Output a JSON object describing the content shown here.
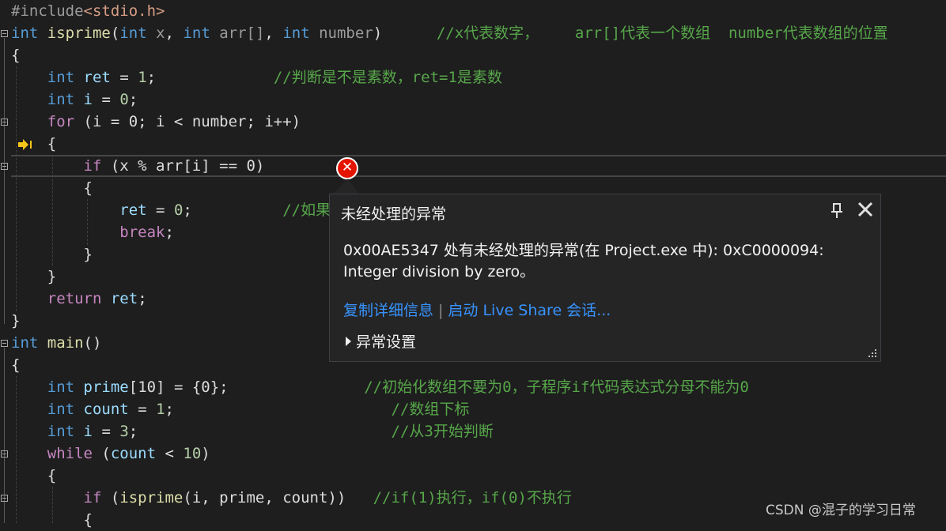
{
  "code": {
    "include": {
      "pp": "#include",
      "file": "<stdio.h>"
    },
    "l1": {
      "kw": "int",
      "fn": "isprime",
      "a1": "int",
      "p1": "x",
      "a2": "int",
      "p2": "arr[]",
      "a3": "int",
      "p3": "number",
      "cm": "//x代表数字，    arr[]代表一个数组  number代表数组的位置"
    },
    "l2": "{",
    "l3": {
      "kw": "int",
      "id": "ret",
      "num": "1",
      "cm": "//判断是不是素数，ret=1是素数"
    },
    "l4": {
      "kw": "int",
      "id": "i",
      "num": "0"
    },
    "l5": {
      "kw": "for",
      "rest": "(i = 0; i < number; i++)"
    },
    "l6": "{",
    "l7": {
      "kw": "if",
      "rest": "(x % arr[i] == 0)"
    },
    "l8": "{",
    "l9": {
      "id": "ret",
      "num": "0",
      "cm": "//如果"
    },
    "l10": {
      "kw": "break"
    },
    "l11": "}",
    "l12": "}",
    "l13": {
      "kw": "return",
      "id": "ret"
    },
    "l14": "}",
    "l15": {
      "kw": "int",
      "fn": "main",
      "rest": "()"
    },
    "l16": "{",
    "l17": {
      "kw": "int",
      "id": "prime",
      "rest": "[10] = {0};",
      "cm": "//初始化数组不要为0，子程序if代码表达式分母不能为0"
    },
    "l18": {
      "kw": "int",
      "id": "count",
      "num": "1",
      "cm": "//数组下标"
    },
    "l19": {
      "kw": "int",
      "id": "i",
      "num": "3",
      "cm": "//从3开始判断"
    },
    "l20": {
      "kw": "while",
      "id": "count",
      "num": "10"
    },
    "l21": "{",
    "l22": {
      "kw": "if",
      "fn": "isprime",
      "args": "(i, prime, count))",
      "cm": "//if(1)执行，if(0)不执行"
    },
    "l23": "{"
  },
  "popup": {
    "title": "未经处理的异常",
    "message": "0x00AE5347 处有未经处理的异常(在 Project.exe 中): 0xC0000094: Integer division by zero。",
    "link_copy": "复制详细信息",
    "link_share": "启动 Live Share 会话...",
    "settings": "异常设置",
    "pin_icon": "pin-icon",
    "close_icon": "close-icon"
  },
  "watermark": "CSDN @混子的学习日常",
  "colors": {
    "keyword": "#569cd6",
    "comment": "#57a64a",
    "number": "#b5cea8",
    "function": "#dcdcaa",
    "link": "#3794ff",
    "error": "#e51400"
  }
}
